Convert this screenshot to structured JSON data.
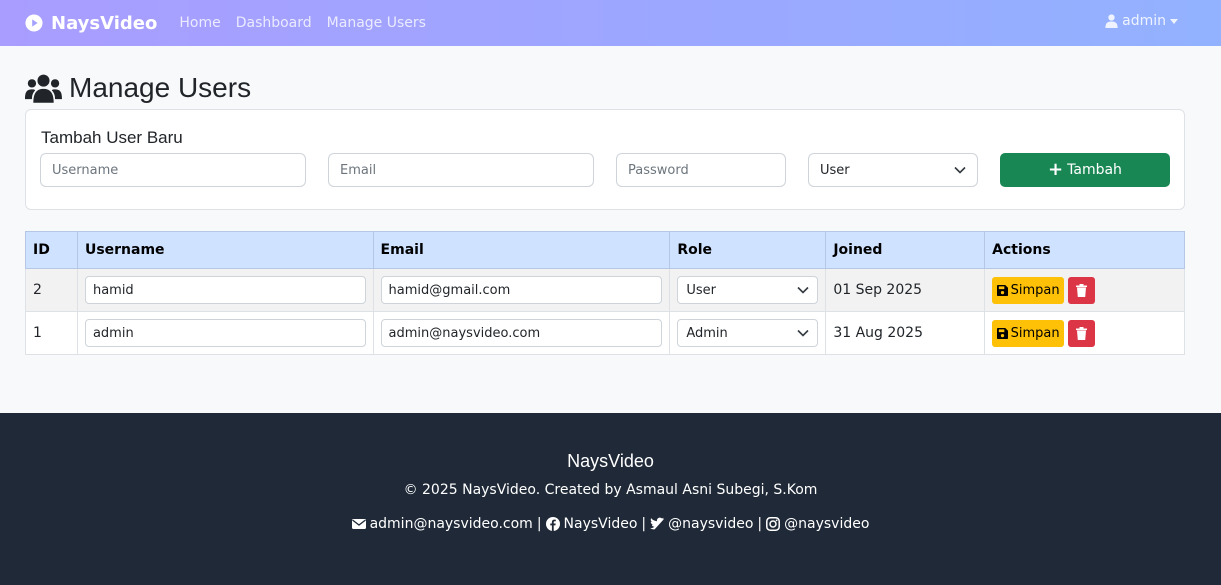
{
  "navbar": {
    "brand": "NaysVideo",
    "links": [
      "Home",
      "Dashboard",
      "Manage Users"
    ],
    "user": "admin"
  },
  "page": {
    "title": "Manage Users"
  },
  "add_form": {
    "title": "Tambah User Baru",
    "username_placeholder": "Username",
    "email_placeholder": "Email",
    "password_placeholder": "Password",
    "role_selected": "User",
    "submit_label": "Tambah"
  },
  "table": {
    "headers": [
      "ID",
      "Username",
      "Email",
      "Role",
      "Joined",
      "Actions"
    ],
    "rows": [
      {
        "id": "2",
        "username": "hamid",
        "email": "hamid@gmail.com",
        "role": "User",
        "joined": "01 Sep 2025",
        "save_label": "Simpan"
      },
      {
        "id": "1",
        "username": "admin",
        "email": "admin@naysvideo.com",
        "role": "Admin",
        "joined": "31 Aug 2025",
        "save_label": "Simpan"
      }
    ]
  },
  "footer": {
    "brand": "NaysVideo",
    "copyright": "© 2025 NaysVideo. Created by Asmaul Asni Subegi, S.Kom",
    "email": "admin@naysvideo.com",
    "facebook": "NaysVideo",
    "twitter": "@naysvideo",
    "instagram": "@naysvideo",
    "separator": "|"
  },
  "colors": {
    "primary_green": "#198754",
    "warning_yellow": "#ffc107",
    "danger_red": "#dc3545",
    "table_header": "#cfe2ff",
    "footer_bg": "#1f2937"
  }
}
